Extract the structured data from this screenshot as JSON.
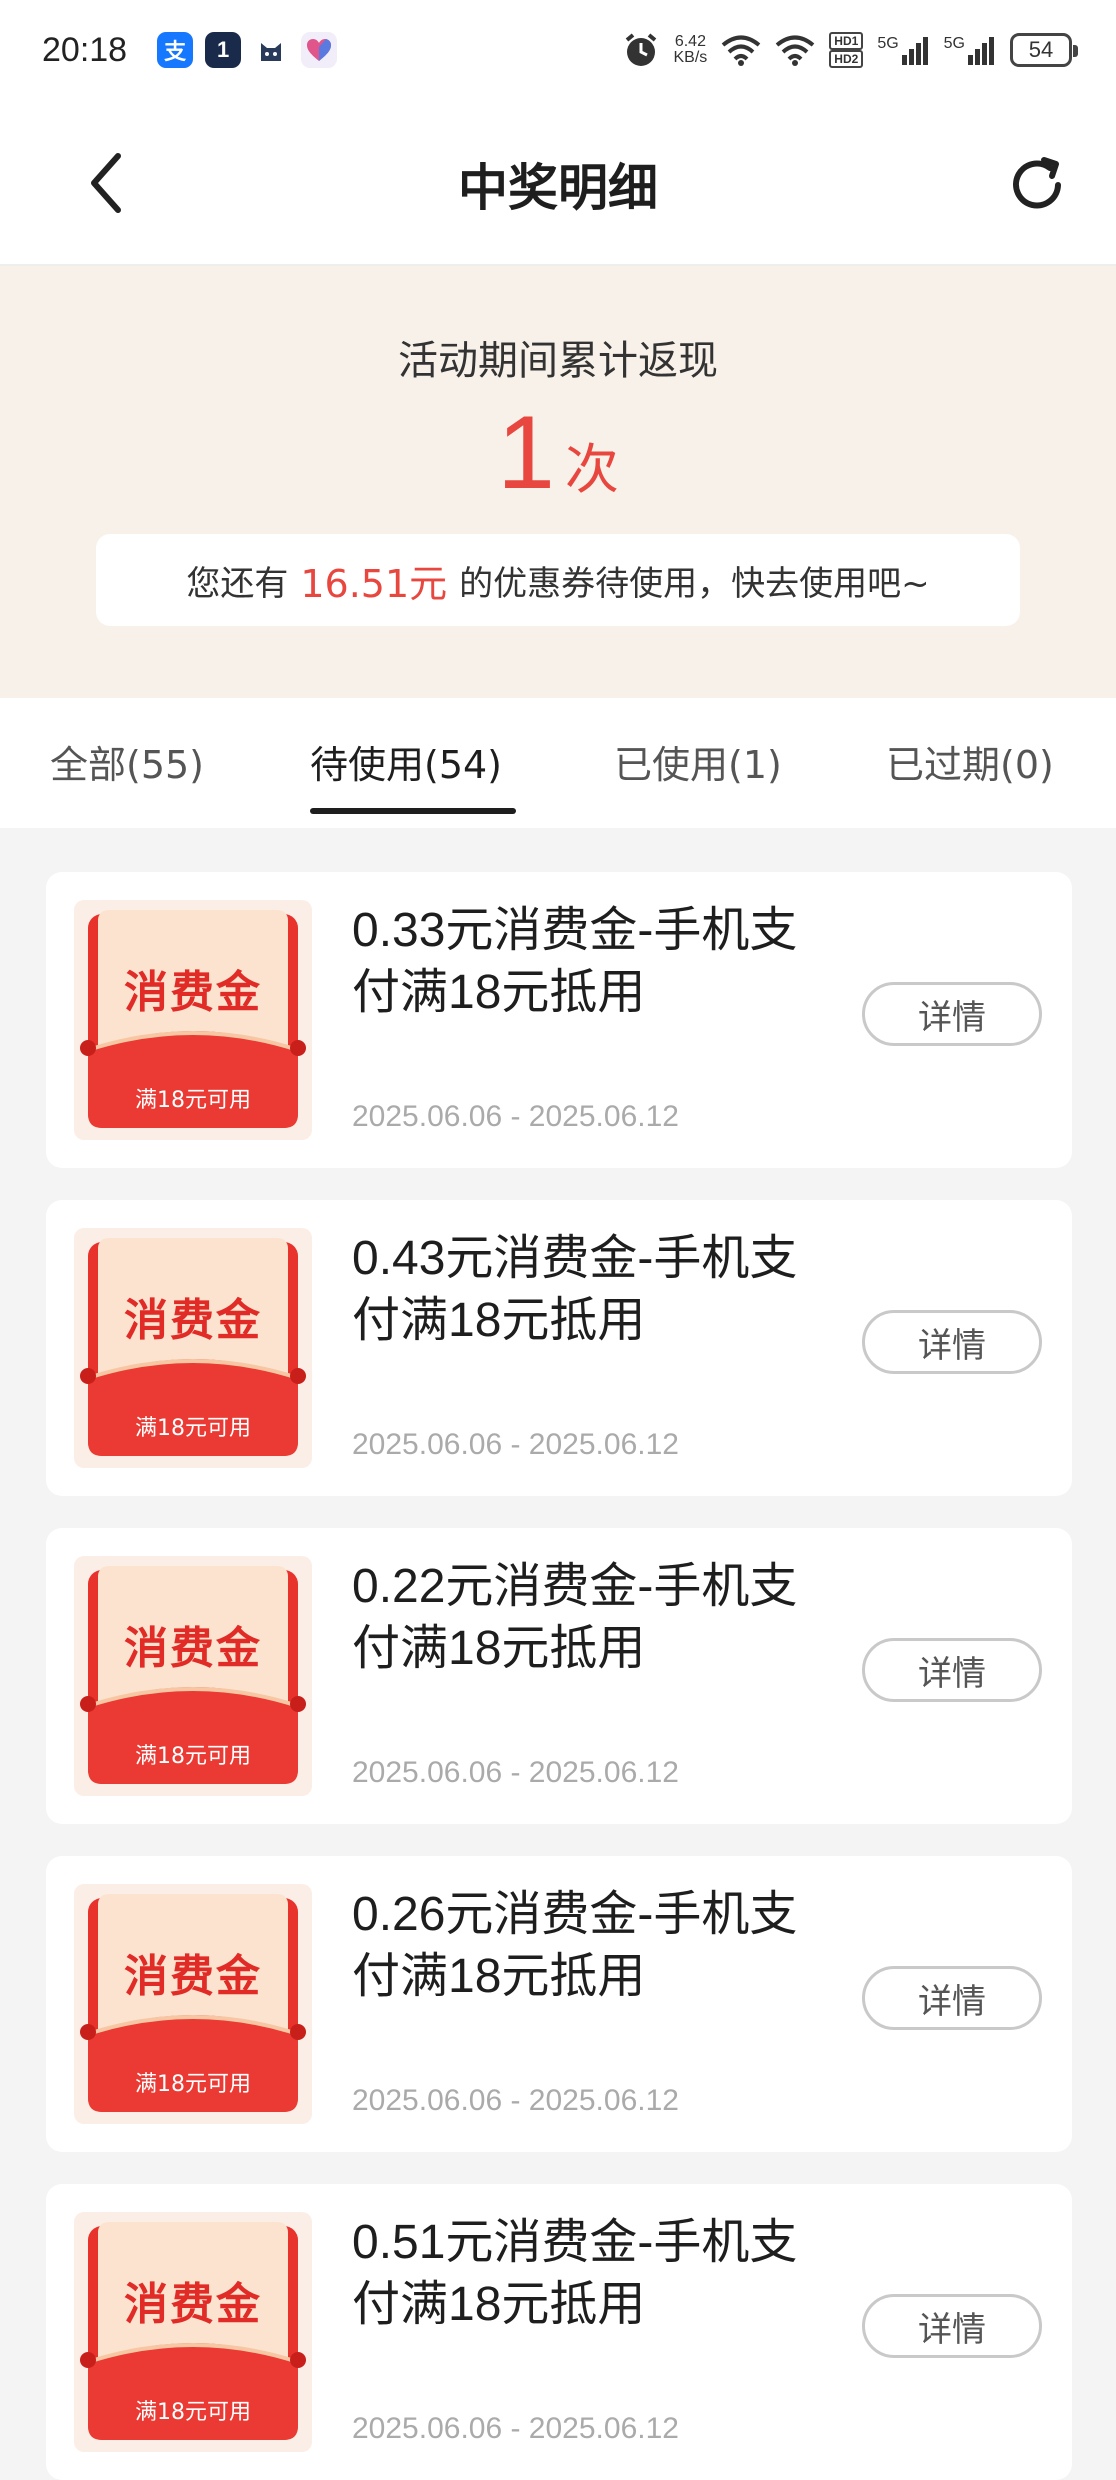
{
  "status_bar": {
    "time": "20:18",
    "apps": [
      {
        "name": "alipay-icon",
        "glyph": "支",
        "color": "#1677ff"
      },
      {
        "name": "app-icon",
        "glyph": "1",
        "color": "#1a2a4a"
      },
      {
        "name": "cat-icon",
        "glyph": "🐱",
        "color": "#ffffff"
      },
      {
        "name": "heart-icon",
        "glyph": "♥",
        "color": "#ffffff"
      }
    ],
    "net_speed_value": "6.42",
    "net_speed_unit": "KB/s",
    "hd1": "HD1",
    "hd2": "HD2",
    "sig1": "5G",
    "sig2": "5G",
    "battery": "54"
  },
  "header": {
    "title": "中奖明细"
  },
  "summary": {
    "label": "活动期间累计返现",
    "count": "1",
    "count_unit": "次",
    "notice_prefix": "您还有",
    "notice_amount": "16.51元",
    "notice_suffix": "的优惠券待使用，快去使用吧~"
  },
  "tabs": [
    {
      "label": "全部(55)",
      "active": false
    },
    {
      "label": "待使用(54)",
      "active": true
    },
    {
      "label": "已使用(1)",
      "active": false
    },
    {
      "label": "已过期(0)",
      "active": false
    }
  ],
  "coupons": [
    {
      "art_title": "消费金",
      "art_sub": "满18元可用",
      "title_line1": "0.33元消费金-手机支",
      "title_line2": "付满18元抵用",
      "date": "2025.06.06 - 2025.06.12",
      "button": "详情"
    },
    {
      "art_title": "消费金",
      "art_sub": "满18元可用",
      "title_line1": "0.43元消费金-手机支",
      "title_line2": "付满18元抵用",
      "date": "2025.06.06 - 2025.06.12",
      "button": "详情"
    },
    {
      "art_title": "消费金",
      "art_sub": "满18元可用",
      "title_line1": "0.22元消费金-手机支",
      "title_line2": "付满18元抵用",
      "date": "2025.06.06 - 2025.06.12",
      "button": "详情"
    },
    {
      "art_title": "消费金",
      "art_sub": "满18元可用",
      "title_line1": "0.26元消费金-手机支",
      "title_line2": "付满18元抵用",
      "date": "2025.06.06 - 2025.06.12",
      "button": "详情"
    },
    {
      "art_title": "消费金",
      "art_sub": "满18元可用",
      "title_line1": "0.51元消费金-手机支",
      "title_line2": "付满18元抵用",
      "date": "2025.06.06 - 2025.06.12",
      "button": "详情"
    }
  ],
  "colors": {
    "accent_red": "#e8473f",
    "summary_bg": "#f8f1ea",
    "page_bg": "#f4f4f4"
  }
}
